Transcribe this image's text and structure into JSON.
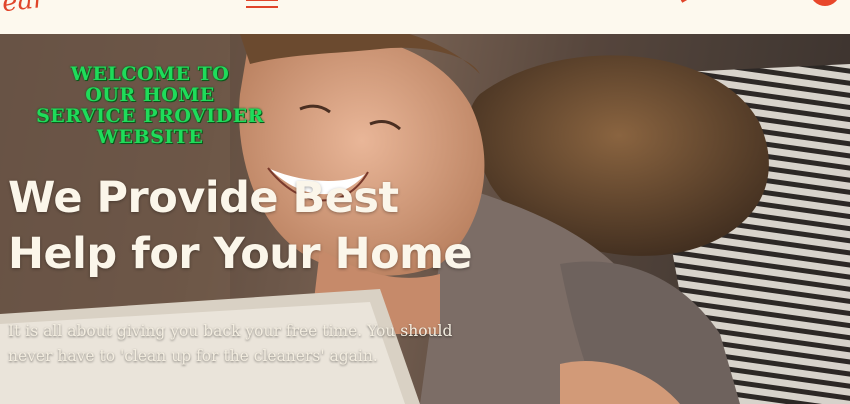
{
  "colors": {
    "accent": "#e0452a",
    "welcome_text": "#1fdc5a",
    "headline_text": "#fbf6ea",
    "top_bar_bg": "#fdf9ee"
  },
  "header": {
    "logo_text": "ear",
    "menu_icon": "hamburger-menu-icon",
    "circle_button_icon": "circle-button"
  },
  "hero": {
    "welcome_lines": [
      "WELCOME TO",
      "OUR HOME",
      "SERVICE PROVIDER",
      "WEBSITE"
    ],
    "headline_lines": [
      "We Provide Best",
      "Help for Your Home"
    ],
    "subtext_lines": [
      "It is all about giving you back your free time. You should",
      "never have to 'clean up for the cleaners' again."
    ]
  }
}
